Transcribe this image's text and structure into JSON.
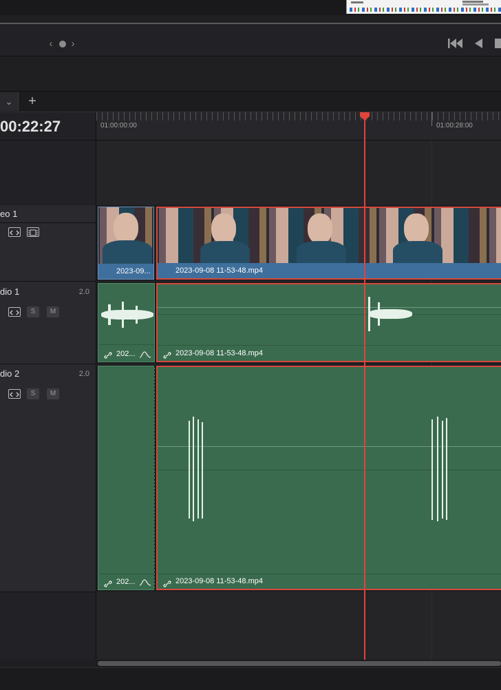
{
  "header": {
    "timecode": "00:22:27"
  },
  "ruler": {
    "label_start": "01:00:00:00",
    "label_mark": "01:00:28:00"
  },
  "tracks": {
    "video1": {
      "name": "eo 1"
    },
    "audio1": {
      "name": "dio 1",
      "channels": "2.0",
      "solo": "S",
      "mute": "M"
    },
    "audio2": {
      "name": "dio 2",
      "channels": "2.0",
      "solo": "S",
      "mute": "M"
    }
  },
  "clips": {
    "video_a": "2023-09...",
    "video_b": "2023-09-08 11-53-48.mp4",
    "audio1_a": "202...",
    "audio1_b": "2023-09-08 11-53-48.mp4",
    "audio2_a": "202...",
    "audio2_b": "2023-09-08 11-53-48.mp4"
  },
  "colors": {
    "playhead": "#e0443a",
    "video_clip": "#3d6e9e",
    "audio_clip": "#3a6b4e",
    "selection": "#d6493c"
  }
}
